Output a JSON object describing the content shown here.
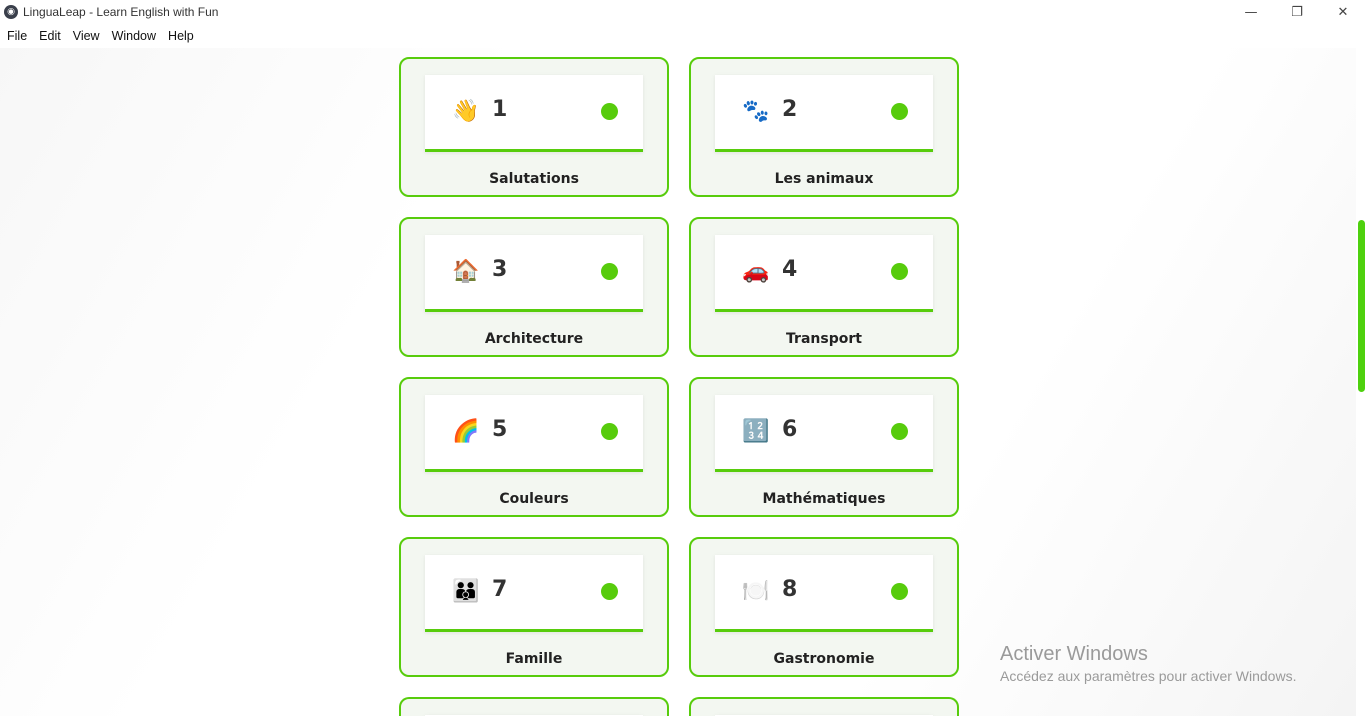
{
  "window": {
    "title": "LinguaLeap - Learn English with Fun",
    "controls": {
      "minimize": "—",
      "maximize": "❐",
      "close": "✕"
    }
  },
  "menu": [
    "File",
    "Edit",
    "View",
    "Window",
    "Help"
  ],
  "accent_color": "#57cc0c",
  "lessons": [
    {
      "icon": "waving-hand-icon",
      "emoji": "👋",
      "number": "1",
      "label": "Salutations"
    },
    {
      "icon": "paw-prints-icon",
      "emoji": "🐾",
      "number": "2",
      "label": "Les animaux"
    },
    {
      "icon": "house-icon",
      "emoji": "🏠",
      "number": "3",
      "label": "Architecture"
    },
    {
      "icon": "car-icon",
      "emoji": "🚗",
      "number": "4",
      "label": "Transport"
    },
    {
      "icon": "rainbow-icon",
      "emoji": "🌈",
      "number": "5",
      "label": "Couleurs"
    },
    {
      "icon": "numbers-icon",
      "emoji": "🔢",
      "number": "6",
      "label": "Mathématiques"
    },
    {
      "icon": "family-icon",
      "emoji": "👪",
      "number": "7",
      "label": "Famille"
    },
    {
      "icon": "plate-icon",
      "emoji": "🍽️",
      "number": "8",
      "label": "Gastronomie"
    }
  ],
  "watermark": {
    "title": "Activer Windows",
    "subtitle": "Accédez aux paramètres pour activer Windows."
  }
}
